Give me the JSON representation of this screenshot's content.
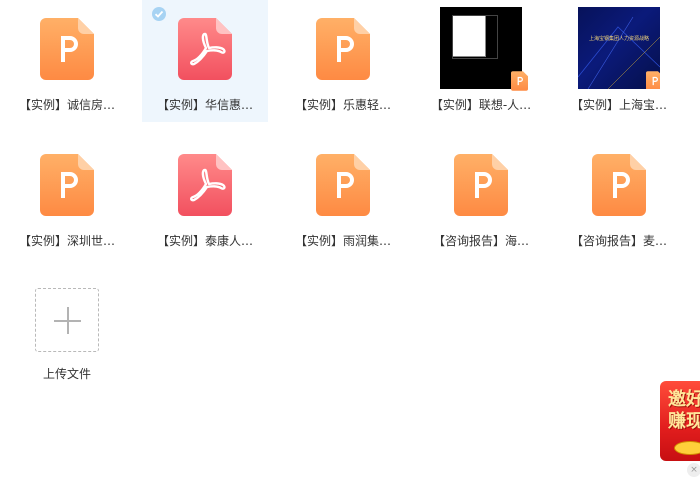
{
  "files": [
    {
      "name": "【实例】诚信房…",
      "type": "ppt",
      "selected": false
    },
    {
      "name": "【实例】华信惠…",
      "type": "pdf",
      "selected": true
    },
    {
      "name": "【实例】乐惠轻…",
      "type": "ppt",
      "selected": false
    },
    {
      "name": "【实例】联想-人…",
      "type": "image-black",
      "selected": false
    },
    {
      "name": "【实例】上海宝…",
      "type": "image-navy",
      "selected": false,
      "thumb_caption": "上海宝钢集团人力资源战略"
    },
    {
      "name": "【实例】深圳世…",
      "type": "ppt",
      "selected": false
    },
    {
      "name": "【实例】泰康人…",
      "type": "pdf",
      "selected": false
    },
    {
      "name": "【实例】雨润集…",
      "type": "ppt",
      "selected": false
    },
    {
      "name": "【咨询报告】海…",
      "type": "ppt",
      "selected": false
    },
    {
      "name": "【咨询报告】麦…",
      "type": "ppt",
      "selected": false
    }
  ],
  "upload": {
    "label": "上传文件"
  },
  "promo": {
    "line1": "邀好",
    "line2": "赚现",
    "close": "×"
  },
  "colors": {
    "ppt_top": "#ffb067",
    "ppt_bottom": "#fe8a43",
    "pdf_top": "#ff8a8a",
    "pdf_bottom": "#f2505f",
    "selected_bg": "#eef6fd",
    "check": "#a7d3f3",
    "text": "#333333"
  }
}
